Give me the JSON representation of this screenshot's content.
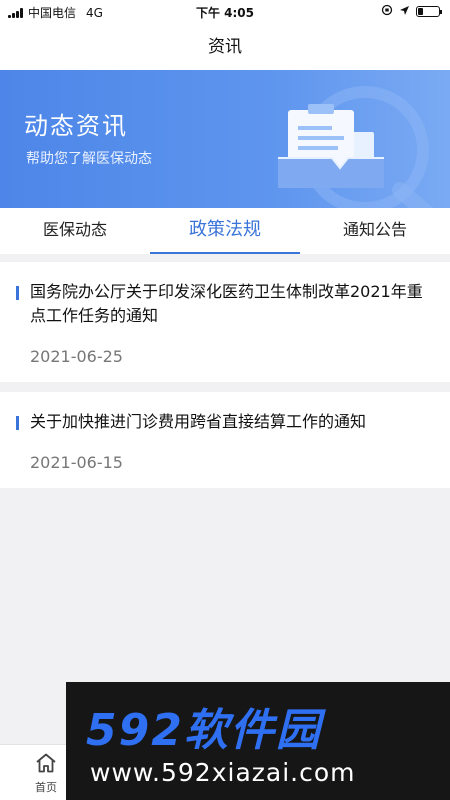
{
  "status": {
    "carrier": "中国电信",
    "network": "4G",
    "time": "下午 4:05"
  },
  "nav": {
    "title": "资讯"
  },
  "banner": {
    "title": "动态资讯",
    "subtitle": "帮助您了解医保动态"
  },
  "tabs": [
    {
      "label": "医保动态",
      "active": false
    },
    {
      "label": "政策法规",
      "active": true
    },
    {
      "label": "通知公告",
      "active": false
    }
  ],
  "news": [
    {
      "title": "国务院办公厅关于印发深化医药卫生体制改革2021年重点工作任务的通知",
      "date": "2021-06-25"
    },
    {
      "title": "关于加快推进门诊费用跨省直接结算工作的通知",
      "date": "2021-06-15"
    }
  ],
  "bottom_nav": {
    "home_label": "首页"
  },
  "watermark": {
    "brand": "592软件园",
    "url": "www.592xiazai.com"
  },
  "colors": {
    "accent": "#3a74d8",
    "banner": "#4d86e8",
    "background": "#f1f1f3"
  }
}
